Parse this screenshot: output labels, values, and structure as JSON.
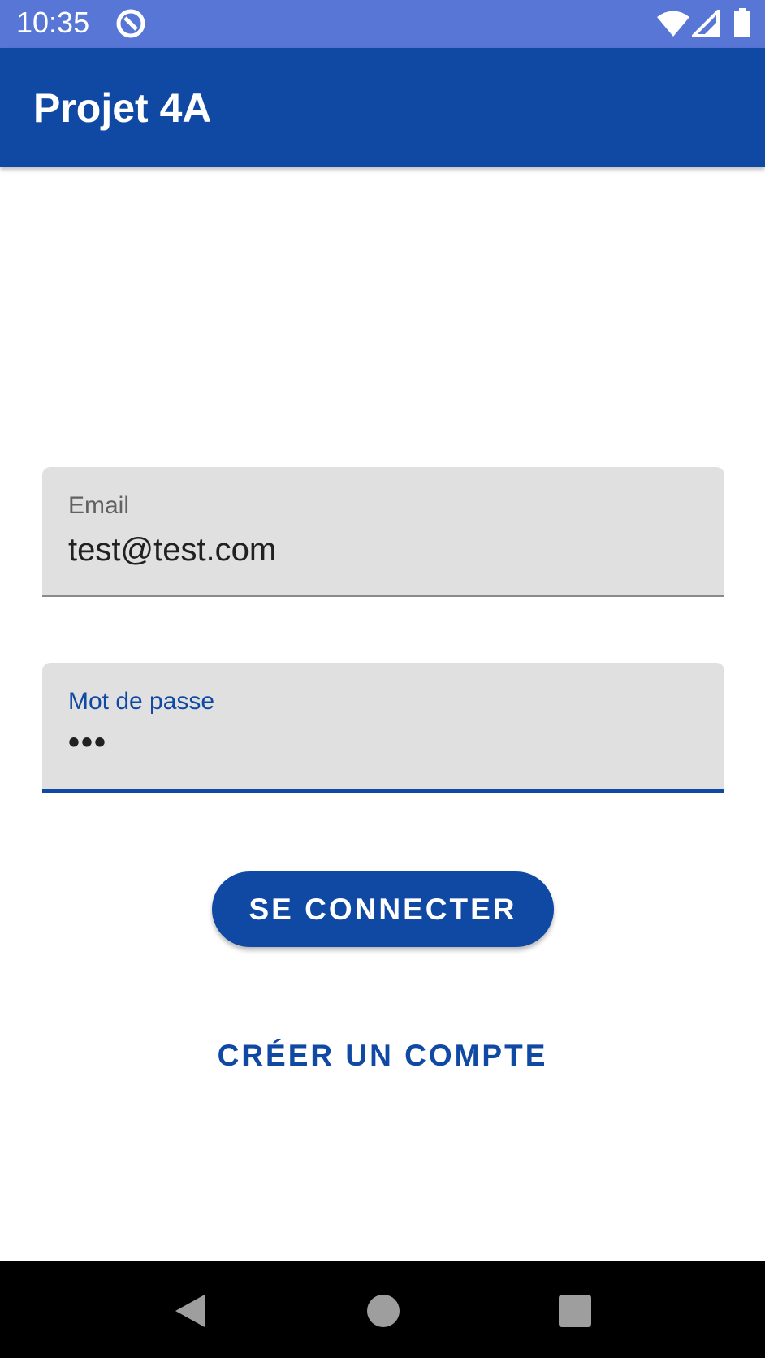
{
  "status_bar": {
    "time": "10:35",
    "icons": [
      "app-notification-icon",
      "wifi-icon",
      "cell-signal-icon",
      "battery-icon"
    ],
    "background": "#5876d6"
  },
  "app_bar": {
    "title": "Projet 4A",
    "background": "#0f49a3"
  },
  "form": {
    "email": {
      "label": "Email",
      "value": "test@test.com"
    },
    "password": {
      "label": "Mot de passe",
      "value": "•••"
    },
    "login_button": "SE CONNECTER",
    "create_account_button": "CRÉER UN COMPTE"
  },
  "nav_bar": {
    "icons": [
      "back-icon",
      "home-icon",
      "recents-icon"
    ]
  },
  "colors": {
    "primary": "#0f49a3",
    "field_background": "#e0e0e0",
    "status_bar": "#5876d6"
  }
}
